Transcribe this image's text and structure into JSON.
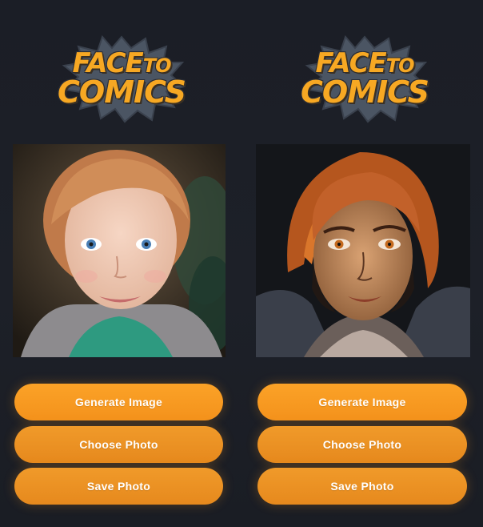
{
  "brand": {
    "line1_big": "FACE",
    "line1_small": "TO",
    "line2": "COMICS",
    "accent_color": "#f7a823",
    "badge_color": "#4b5563"
  },
  "panels": [
    {
      "id": "original",
      "photo_icon": "portrait-photo",
      "buttons": {
        "generate": "Generate  Image",
        "choose": "Choose Photo",
        "save": "Save Photo"
      }
    },
    {
      "id": "comic",
      "photo_icon": "comic-portrait",
      "buttons": {
        "generate": "Generate  Image",
        "choose": "Choose Photo",
        "save": "Save Photo"
      }
    }
  ],
  "colors": {
    "background": "#1c1f27",
    "button": "#f4921c",
    "button_text": "#ffffff"
  }
}
